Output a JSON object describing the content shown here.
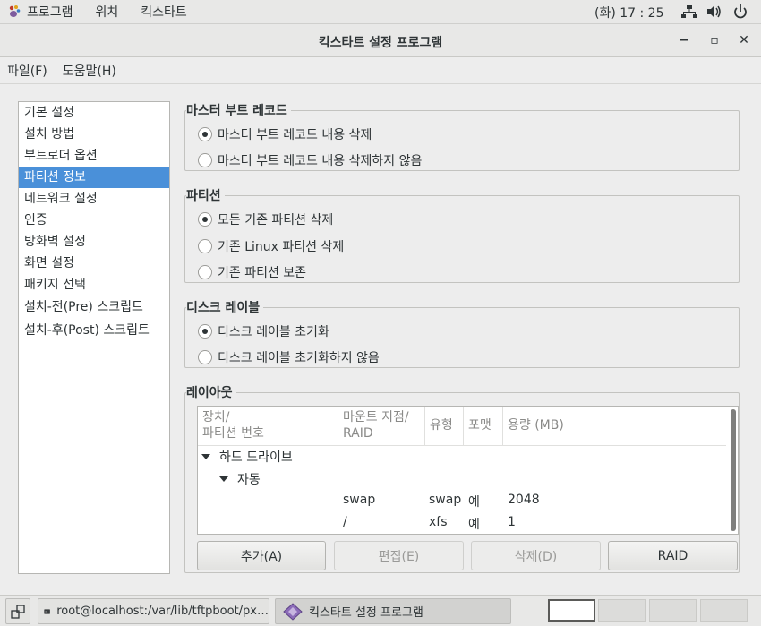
{
  "top_panel": {
    "apps_label": "프로그램",
    "places_label": "위치",
    "app_label": "킥스타트",
    "clock": "(화) 17 : 25"
  },
  "window": {
    "title": "킥스타트 설정 프로그램",
    "minimize": "−",
    "maximize": "▫",
    "close": "✕"
  },
  "menubar": {
    "file": "파일(F)",
    "help": "도움말(H)"
  },
  "sidebar": {
    "items": [
      {
        "label": "기본 설정"
      },
      {
        "label": "설치 방법"
      },
      {
        "label": "부트로더 옵션"
      },
      {
        "label": "파티션 정보"
      },
      {
        "label": "네트워크 설정"
      },
      {
        "label": "인증"
      },
      {
        "label": "방화벽 설정"
      },
      {
        "label": "화면 설정"
      },
      {
        "label": "패키지 선택"
      },
      {
        "label": "설치-전(Pre) 스크립트"
      },
      {
        "label": "설치-후(Post) 스크립트"
      }
    ],
    "selected_index": 3
  },
  "mbr": {
    "title": "마스터 부트 레코드",
    "options": [
      "마스터 부트 레코드 내용 삭제",
      "마스터 부트 레코드 내용 삭제하지 않음"
    ],
    "selected": 0
  },
  "partition": {
    "title": "파티션",
    "options": [
      "모든 기존 파티션 삭제",
      "기존 Linux 파티션 삭제",
      "기존 파티션 보존"
    ],
    "selected": 0
  },
  "disklabel": {
    "title": "디스크 레이블",
    "options": [
      "디스크 레이블 초기화",
      "디스크 레이블 초기화하지 않음"
    ],
    "selected": 0
  },
  "layout": {
    "title": "레이아웃",
    "columns": {
      "device_1": "장치/",
      "device_2": "파티션 번호",
      "mount_1": "마운트 지점/",
      "mount_2": "RAID",
      "type": "유형",
      "format": "포맷",
      "size": "용량 (MB)"
    },
    "tree": {
      "root": "하드 드라이브",
      "child": "자동",
      "rows": [
        {
          "mount": "swap",
          "type": "swap",
          "format": "예",
          "size": "2048"
        },
        {
          "mount": "/",
          "type": "xfs",
          "format": "예",
          "size": "1"
        }
      ]
    },
    "buttons": {
      "add": "추가(A)",
      "edit": "편집(E)",
      "delete": "삭제(D)",
      "raid": "RAID"
    }
  },
  "taskbar": {
    "terminal_task": "root@localhost:/var/lib/tftpboot/px…",
    "app_task": "킥스타트 설정 프로그램"
  },
  "colors": {
    "selection": "#4a90d9",
    "panel_bg": "#e8e8e7",
    "window_bg": "#ededed"
  }
}
